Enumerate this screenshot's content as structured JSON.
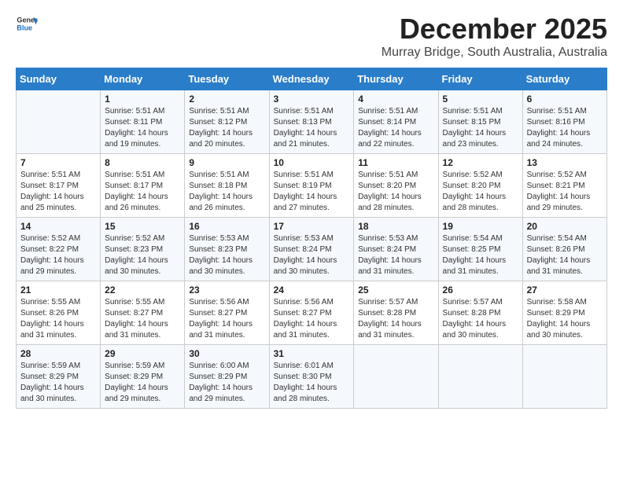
{
  "header": {
    "logo_general": "General",
    "logo_blue": "Blue",
    "month_year": "December 2025",
    "location": "Murray Bridge, South Australia, Australia"
  },
  "weekdays": [
    "Sunday",
    "Monday",
    "Tuesday",
    "Wednesday",
    "Thursday",
    "Friday",
    "Saturday"
  ],
  "rows": [
    [
      {
        "day": "",
        "sunrise": "",
        "sunset": "",
        "daylight": ""
      },
      {
        "day": "1",
        "sunrise": "Sunrise: 5:51 AM",
        "sunset": "Sunset: 8:11 PM",
        "daylight": "Daylight: 14 hours and 19 minutes."
      },
      {
        "day": "2",
        "sunrise": "Sunrise: 5:51 AM",
        "sunset": "Sunset: 8:12 PM",
        "daylight": "Daylight: 14 hours and 20 minutes."
      },
      {
        "day": "3",
        "sunrise": "Sunrise: 5:51 AM",
        "sunset": "Sunset: 8:13 PM",
        "daylight": "Daylight: 14 hours and 21 minutes."
      },
      {
        "day": "4",
        "sunrise": "Sunrise: 5:51 AM",
        "sunset": "Sunset: 8:14 PM",
        "daylight": "Daylight: 14 hours and 22 minutes."
      },
      {
        "day": "5",
        "sunrise": "Sunrise: 5:51 AM",
        "sunset": "Sunset: 8:15 PM",
        "daylight": "Daylight: 14 hours and 23 minutes."
      },
      {
        "day": "6",
        "sunrise": "Sunrise: 5:51 AM",
        "sunset": "Sunset: 8:16 PM",
        "daylight": "Daylight: 14 hours and 24 minutes."
      }
    ],
    [
      {
        "day": "7",
        "sunrise": "Sunrise: 5:51 AM",
        "sunset": "Sunset: 8:17 PM",
        "daylight": "Daylight: 14 hours and 25 minutes."
      },
      {
        "day": "8",
        "sunrise": "Sunrise: 5:51 AM",
        "sunset": "Sunset: 8:17 PM",
        "daylight": "Daylight: 14 hours and 26 minutes."
      },
      {
        "day": "9",
        "sunrise": "Sunrise: 5:51 AM",
        "sunset": "Sunset: 8:18 PM",
        "daylight": "Daylight: 14 hours and 26 minutes."
      },
      {
        "day": "10",
        "sunrise": "Sunrise: 5:51 AM",
        "sunset": "Sunset: 8:19 PM",
        "daylight": "Daylight: 14 hours and 27 minutes."
      },
      {
        "day": "11",
        "sunrise": "Sunrise: 5:51 AM",
        "sunset": "Sunset: 8:20 PM",
        "daylight": "Daylight: 14 hours and 28 minutes."
      },
      {
        "day": "12",
        "sunrise": "Sunrise: 5:52 AM",
        "sunset": "Sunset: 8:20 PM",
        "daylight": "Daylight: 14 hours and 28 minutes."
      },
      {
        "day": "13",
        "sunrise": "Sunrise: 5:52 AM",
        "sunset": "Sunset: 8:21 PM",
        "daylight": "Daylight: 14 hours and 29 minutes."
      }
    ],
    [
      {
        "day": "14",
        "sunrise": "Sunrise: 5:52 AM",
        "sunset": "Sunset: 8:22 PM",
        "daylight": "Daylight: 14 hours and 29 minutes."
      },
      {
        "day": "15",
        "sunrise": "Sunrise: 5:52 AM",
        "sunset": "Sunset: 8:23 PM",
        "daylight": "Daylight: 14 hours and 30 minutes."
      },
      {
        "day": "16",
        "sunrise": "Sunrise: 5:53 AM",
        "sunset": "Sunset: 8:23 PM",
        "daylight": "Daylight: 14 hours and 30 minutes."
      },
      {
        "day": "17",
        "sunrise": "Sunrise: 5:53 AM",
        "sunset": "Sunset: 8:24 PM",
        "daylight": "Daylight: 14 hours and 30 minutes."
      },
      {
        "day": "18",
        "sunrise": "Sunrise: 5:53 AM",
        "sunset": "Sunset: 8:24 PM",
        "daylight": "Daylight: 14 hours and 31 minutes."
      },
      {
        "day": "19",
        "sunrise": "Sunrise: 5:54 AM",
        "sunset": "Sunset: 8:25 PM",
        "daylight": "Daylight: 14 hours and 31 minutes."
      },
      {
        "day": "20",
        "sunrise": "Sunrise: 5:54 AM",
        "sunset": "Sunset: 8:26 PM",
        "daylight": "Daylight: 14 hours and 31 minutes."
      }
    ],
    [
      {
        "day": "21",
        "sunrise": "Sunrise: 5:55 AM",
        "sunset": "Sunset: 8:26 PM",
        "daylight": "Daylight: 14 hours and 31 minutes."
      },
      {
        "day": "22",
        "sunrise": "Sunrise: 5:55 AM",
        "sunset": "Sunset: 8:27 PM",
        "daylight": "Daylight: 14 hours and 31 minutes."
      },
      {
        "day": "23",
        "sunrise": "Sunrise: 5:56 AM",
        "sunset": "Sunset: 8:27 PM",
        "daylight": "Daylight: 14 hours and 31 minutes."
      },
      {
        "day": "24",
        "sunrise": "Sunrise: 5:56 AM",
        "sunset": "Sunset: 8:27 PM",
        "daylight": "Daylight: 14 hours and 31 minutes."
      },
      {
        "day": "25",
        "sunrise": "Sunrise: 5:57 AM",
        "sunset": "Sunset: 8:28 PM",
        "daylight": "Daylight: 14 hours and 31 minutes."
      },
      {
        "day": "26",
        "sunrise": "Sunrise: 5:57 AM",
        "sunset": "Sunset: 8:28 PM",
        "daylight": "Daylight: 14 hours and 30 minutes."
      },
      {
        "day": "27",
        "sunrise": "Sunrise: 5:58 AM",
        "sunset": "Sunset: 8:29 PM",
        "daylight": "Daylight: 14 hours and 30 minutes."
      }
    ],
    [
      {
        "day": "28",
        "sunrise": "Sunrise: 5:59 AM",
        "sunset": "Sunset: 8:29 PM",
        "daylight": "Daylight: 14 hours and 30 minutes."
      },
      {
        "day": "29",
        "sunrise": "Sunrise: 5:59 AM",
        "sunset": "Sunset: 8:29 PM",
        "daylight": "Daylight: 14 hours and 29 minutes."
      },
      {
        "day": "30",
        "sunrise": "Sunrise: 6:00 AM",
        "sunset": "Sunset: 8:29 PM",
        "daylight": "Daylight: 14 hours and 29 minutes."
      },
      {
        "day": "31",
        "sunrise": "Sunrise: 6:01 AM",
        "sunset": "Sunset: 8:30 PM",
        "daylight": "Daylight: 14 hours and 28 minutes."
      },
      {
        "day": "",
        "sunrise": "",
        "sunset": "",
        "daylight": ""
      },
      {
        "day": "",
        "sunrise": "",
        "sunset": "",
        "daylight": ""
      },
      {
        "day": "",
        "sunrise": "",
        "sunset": "",
        "daylight": ""
      }
    ]
  ]
}
